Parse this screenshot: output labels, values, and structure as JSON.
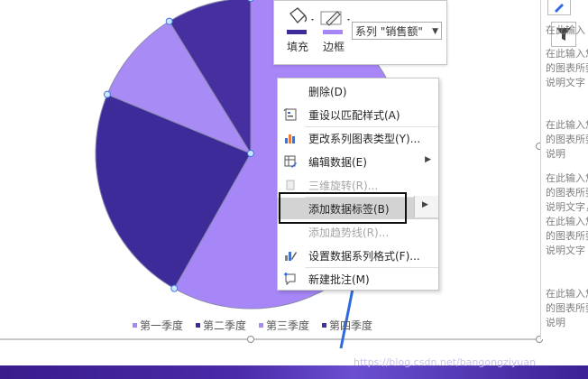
{
  "chart_data": {
    "type": "pie",
    "series_label": "系列 \"销售额\"",
    "categories": [
      "第一季度",
      "第二季度",
      "第三季度",
      "第四季度"
    ],
    "values": [
      58.2,
      23.0,
      10.0,
      8.8
    ],
    "colors": [
      "#a787f7",
      "#3d2b99",
      "#a98bf5",
      "#4630a0"
    ],
    "legend_position": "bottom",
    "legend": [
      "第一季度",
      "第二季度",
      "第三季度",
      "第四季度"
    ]
  },
  "format_toolbar": {
    "fill_label": "填充",
    "border_label": "边框",
    "series_selector": "系列 \"销售额\""
  },
  "context_menu": {
    "items": [
      {
        "label": "删除(D)",
        "enabled": true,
        "icon": "delete-icon"
      },
      {
        "label": "重设以匹配样式(A)",
        "enabled": true,
        "icon": "reset-style-icon"
      },
      {
        "label": "更改系列图表类型(Y)...",
        "enabled": true,
        "icon": "chart-type-icon"
      },
      {
        "label": "编辑数据(E)",
        "enabled": true,
        "icon": "edit-data-icon",
        "submenu": true
      },
      {
        "label": "三维旋转(R)...",
        "enabled": false,
        "icon": "3d-rotation-icon"
      },
      {
        "label": "添加数据标签(B)",
        "enabled": true,
        "icon": "add-data-labels-icon",
        "submenu": true,
        "highlighted": true
      },
      {
        "label": "添加趋势线(R)...",
        "enabled": false,
        "icon": "trendline-icon"
      },
      {
        "label": "设置数据系列格式(F)...",
        "enabled": true,
        "icon": "format-series-icon"
      },
      {
        "label": "新建批注(M)",
        "enabled": true,
        "icon": "new-comment-icon"
      }
    ]
  },
  "right_panel": {
    "paragraphs": [
      "在此输入",
      "在此输入您的图表所要说明文字",
      "在此输入您的图表所要说明",
      "在此输入您的图表所要说明文字，在此输入您的图表所要说明文字",
      "在此输入您的图表所要说明"
    ]
  },
  "watermark": "https://blog.csdn.net/bangongziyuan",
  "colors": {
    "accent": "#2f6ae0",
    "bottom_band": "#3a1c8c"
  }
}
